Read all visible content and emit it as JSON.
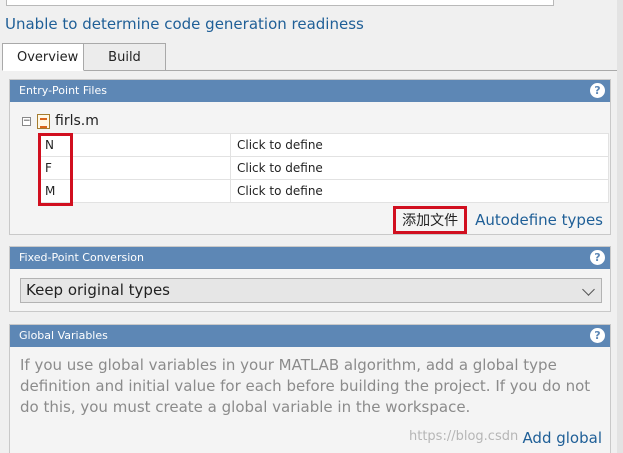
{
  "readiness": "Unable to determine code generation readiness",
  "tabs": [
    {
      "label": "Overview"
    },
    {
      "label": "Build"
    }
  ],
  "entry_panel": {
    "title": "Entry-Point Files",
    "file": "firls.m",
    "args": [
      {
        "name": "N",
        "type": "Click to define"
      },
      {
        "name": "F",
        "type": "Click to define"
      },
      {
        "name": "M",
        "type": "Click to define"
      }
    ],
    "add_file": "添加文件",
    "autodefine": "Autodefine types"
  },
  "fixed_panel": {
    "title": "Fixed-Point Conversion",
    "selected": "Keep original types"
  },
  "global_panel": {
    "title": "Global Variables",
    "text": "If you use global variables in your MATLAB algorithm, add a global type definition and initial value for each before building the project. If you do not do this, you must create a global variable in the workspace.",
    "add_global": "Add global"
  },
  "help_glyph": "?",
  "watermark": "https://blog.csdn",
  "icons": [
    "help-icon",
    "collapse-icon",
    "matlab-file-icon",
    "chevron-down-icon"
  ],
  "colors": {
    "panel_header": "#5d87b5",
    "link": "#1f5f97",
    "highlight_box": "#d10f1f"
  }
}
